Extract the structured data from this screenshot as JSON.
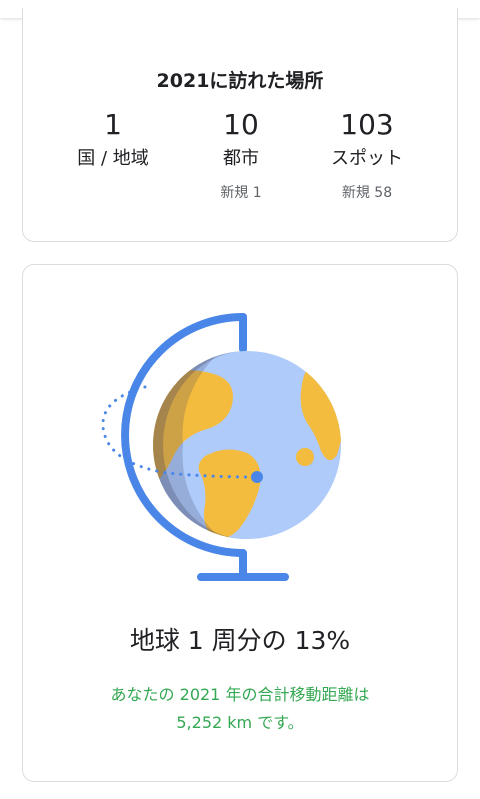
{
  "stats_card": {
    "title": "2021に訪れた場所",
    "items": [
      {
        "value": "1",
        "label": "国 / 地域",
        "sub": ""
      },
      {
        "value": "10",
        "label": "都市",
        "sub": "新規 1"
      },
      {
        "value": "103",
        "label": "スポット",
        "sub": "新規 58"
      }
    ]
  },
  "globe_card": {
    "illustration": "globe-icon",
    "headline": "地球 1 周分の 13%",
    "description_line1": "あなたの 2021 年の合計移動距離は",
    "description_line2": "5,252 km です。"
  },
  "colors": {
    "ocean": "#aecbfa",
    "land": "#f4bc3e",
    "stand": "#4a86e8",
    "accent_green": "#34a853",
    "dots": "#4a86e8"
  }
}
